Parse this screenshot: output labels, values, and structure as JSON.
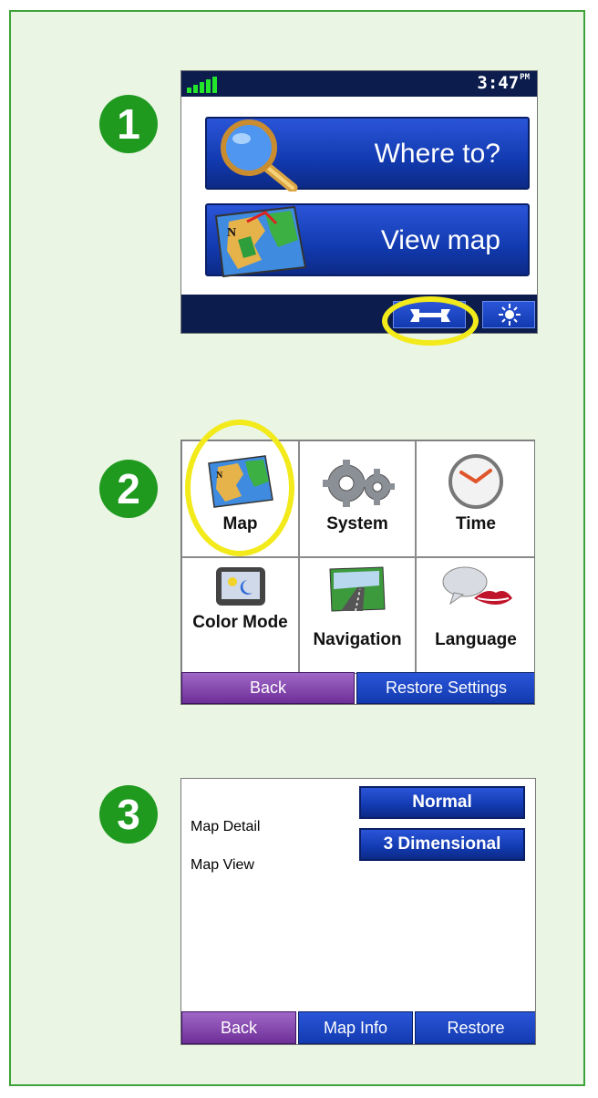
{
  "steps": [
    "1",
    "2",
    "3"
  ],
  "screen1": {
    "clock": "3:47",
    "clock_suffix": "PM",
    "where_to_label": "Where to?",
    "view_map_label": "View map"
  },
  "screen2": {
    "tiles": [
      {
        "label": "Map",
        "icon": "map-icon"
      },
      {
        "label": "System",
        "icon": "gears-icon"
      },
      {
        "label": "Time",
        "icon": "clock-icon"
      },
      {
        "label": "Color Mode",
        "icon": "color-mode-icon"
      },
      {
        "label": "Navigation",
        "icon": "road-icon"
      },
      {
        "label": "Language",
        "icon": "speech-lips-icon"
      }
    ],
    "back_label": "Back",
    "restore_label": "Restore Settings"
  },
  "screen3": {
    "rows": [
      {
        "label": "Map Detail",
        "value": "Normal"
      },
      {
        "label": "Map View",
        "value": "3 Dimensional"
      }
    ],
    "back_label": "Back",
    "map_info_label": "Map Info",
    "restore_label": "Restore"
  },
  "colors": {
    "panel_bg": "#eaf5e4",
    "panel_border": "#3da33a",
    "badge": "#1f9a1f",
    "highlight": "#f2ea1a",
    "button_blue": "#123ab0",
    "button_purple": "#6e2f98",
    "status_bar": "#0b1c4d"
  }
}
